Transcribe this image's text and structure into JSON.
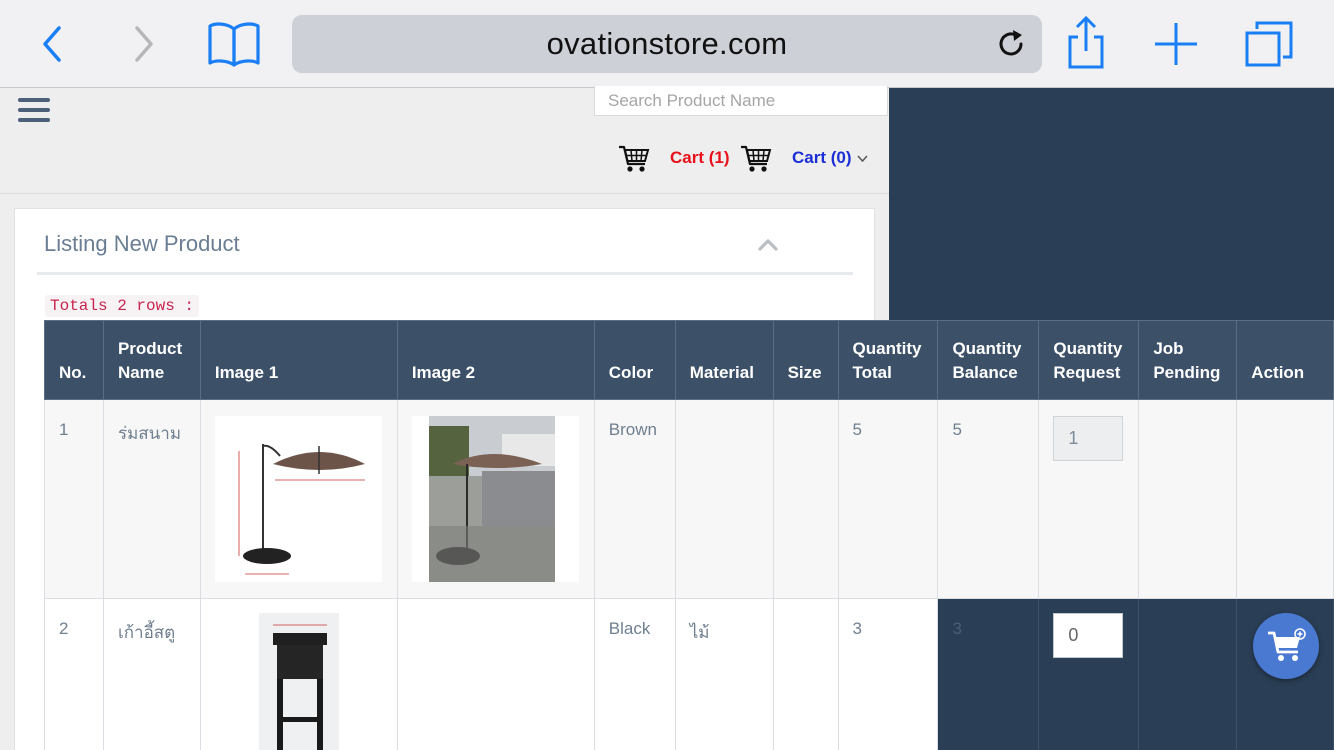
{
  "browser": {
    "url": "ovationstore.com",
    "icons": [
      "back-icon",
      "forward-icon",
      "bookmarks-icon",
      "reload-icon",
      "share-icon",
      "new-tab-icon",
      "tabs-icon"
    ]
  },
  "header": {
    "search_placeholder": "Search Product Name",
    "cart_red": "Cart (1)",
    "cart_blue": "Cart (0)"
  },
  "panel": {
    "title": "Listing New Product",
    "totals": "Totals 2 rows :"
  },
  "table": {
    "columns": [
      {
        "line1": "",
        "line2": "No."
      },
      {
        "line1": "Product",
        "line2": "Name"
      },
      {
        "line1": "",
        "line2": "Image 1"
      },
      {
        "line1": "",
        "line2": "Image 2"
      },
      {
        "line1": "",
        "line2": "Color"
      },
      {
        "line1": "",
        "line2": "Material"
      },
      {
        "line1": "",
        "line2": "Size"
      },
      {
        "line1": "Quantity",
        "line2": "Total"
      },
      {
        "line1": "Quantity",
        "line2": "Balance"
      },
      {
        "line1": "Quantity",
        "line2": "Request"
      },
      {
        "line1": "Job",
        "line2": "Pending"
      },
      {
        "line1": "",
        "line2": "Action"
      }
    ],
    "rows": [
      {
        "no": "1",
        "name": "ร่มสนาม",
        "color": "Brown",
        "material": "",
        "size": "",
        "qty_total": "5",
        "qty_balance": "5",
        "qty_request": "1",
        "job_pending": ""
      },
      {
        "no": "2",
        "name": "เก้าอี้สตู",
        "color": "Black",
        "material": "ไม้",
        "size": "",
        "qty_total": "3",
        "qty_balance": "3",
        "qty_request": "0",
        "job_pending": ""
      }
    ]
  },
  "colors": {
    "header_bg": "#3c5068",
    "page_dark": "#2a3e55",
    "cart_red": "#e8101a",
    "cart_blue": "#1a2fd6",
    "fab": "#4a79d2"
  }
}
